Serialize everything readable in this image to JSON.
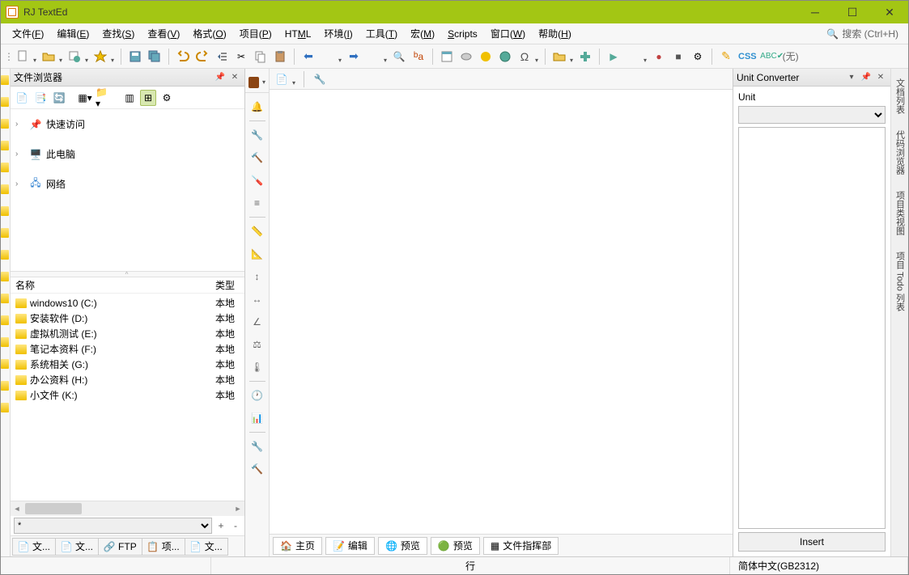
{
  "title": "RJ TextEd",
  "menus": {
    "file": "文件(F)",
    "edit": "编辑(E)",
    "search": "查找(S)",
    "view": "查看(V)",
    "format": "格式(O)",
    "project": "项目(P)",
    "html": "HTML",
    "environment": "环境(I)",
    "tools": "工具(T)",
    "macro": "宏(M)",
    "scripts": "Scripts",
    "window": "窗口(W)",
    "help": "帮助(H)"
  },
  "search_hint": "搜索 (Ctrl+H)",
  "toolbar_right": {
    "css": "CSS",
    "wu": "(无)"
  },
  "explorer": {
    "title": "文件浏览器",
    "tree": {
      "quick": "快速访问",
      "pc": "此电脑",
      "network": "网络"
    },
    "columns": {
      "name": "名称",
      "type": "类型"
    },
    "drives": [
      {
        "name": "windows10 (C:)",
        "type": "本地"
      },
      {
        "name": "安装软件 (D:)",
        "type": "本地"
      },
      {
        "name": "虚拟机测试 (E:)",
        "type": "本地"
      },
      {
        "name": "笔记本资料 (F:)",
        "type": "本地"
      },
      {
        "name": "系统相关 (G:)",
        "type": "本地"
      },
      {
        "name": "办公资料 (H:)",
        "type": "本地"
      },
      {
        "name": "小文件 (K:)",
        "type": "本地"
      }
    ],
    "tabs": {
      "t1": "文...",
      "t2": "文...",
      "ftp": "FTP",
      "proj": "项...",
      "t5": "文..."
    }
  },
  "bottom_tabs": {
    "home": "主页",
    "edit": "编辑",
    "preview1": "预览",
    "preview2": "预览",
    "fc": "文件指挥部"
  },
  "right": {
    "title": "Unit Converter",
    "unit_label": "Unit",
    "insert": "Insert"
  },
  "side_tabs": {
    "t1": "文档列表",
    "t2": "代码浏览器",
    "t3": "项目类视图",
    "t4": "项目 Todo 列表"
  },
  "status": {
    "row": "行",
    "encoding": "简体中文(GB2312)"
  }
}
